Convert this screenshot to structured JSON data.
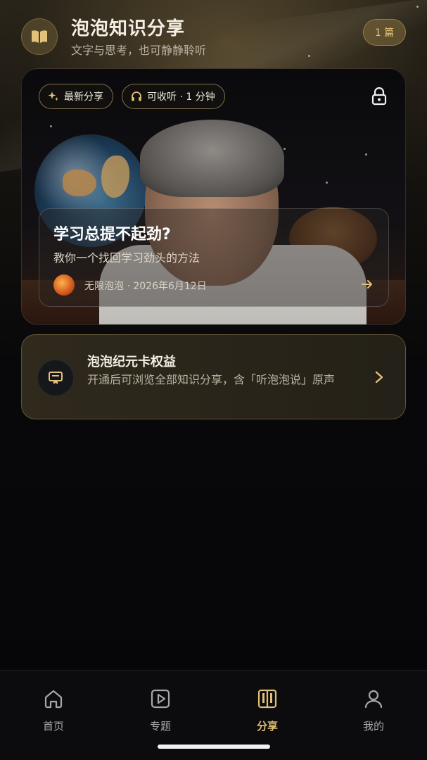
{
  "header": {
    "title": "泡泡知识分享",
    "subtitle": "文字与思考，也可静静聆听",
    "count_badge": "1 篇",
    "logo_icon": "open-book-icon"
  },
  "hero": {
    "chip_latest": "最新分享",
    "chip_audio": "可收听 · 1 分钟",
    "lock_icon": "lock-icon",
    "title": "学习总提不起劲?",
    "subtitle": "教你一个找回学习劲头的方法",
    "author_meta": "无限泡泡 · 2026年6月12日"
  },
  "membership": {
    "title": "泡泡纪元卡权益",
    "description": "开通后可浏览全部知识分享，含「听泡泡说」原声"
  },
  "bottom_nav": {
    "items": [
      {
        "label": "首页",
        "icon": "home-icon",
        "active": false
      },
      {
        "label": "专题",
        "icon": "play-square-icon",
        "active": false
      },
      {
        "label": "分享",
        "icon": "book-share-icon",
        "active": true
      },
      {
        "label": "我的",
        "icon": "user-icon",
        "active": false
      }
    ]
  },
  "colors": {
    "accent": "#e3c074",
    "background": "#060608"
  }
}
